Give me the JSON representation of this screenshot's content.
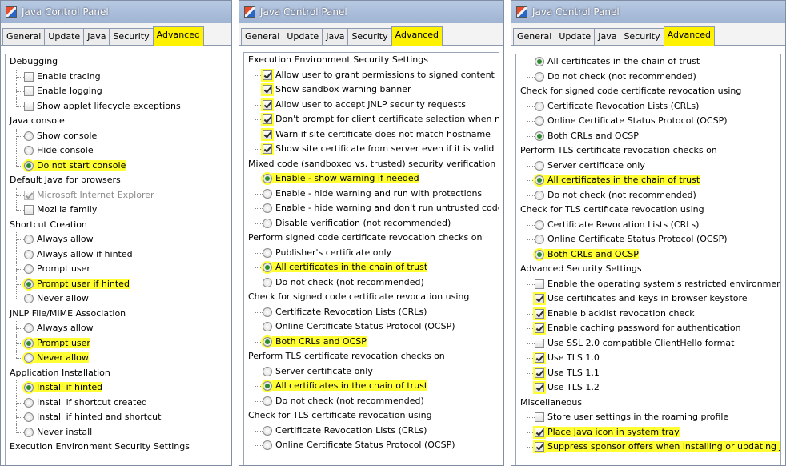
{
  "window_title": "Java Control Panel",
  "tabs": [
    "General",
    "Update",
    "Java",
    "Security",
    "Advanced"
  ],
  "panels": [
    {
      "rows": [
        {
          "kind": "cat",
          "label": "Debugging"
        },
        {
          "kind": "item",
          "ctl": "check",
          "label": "Enable tracing"
        },
        {
          "kind": "item",
          "ctl": "check",
          "label": "Enable logging"
        },
        {
          "kind": "item",
          "ctl": "check",
          "label": "Show applet lifecycle exceptions",
          "last": true
        },
        {
          "kind": "cat",
          "label": "Java console"
        },
        {
          "kind": "item",
          "ctl": "radio",
          "label": "Show console"
        },
        {
          "kind": "item",
          "ctl": "radio",
          "label": "Hide console"
        },
        {
          "kind": "item",
          "ctl": "radio",
          "label": "Do not start console",
          "selected": true,
          "highlight": true,
          "last": true
        },
        {
          "kind": "cat",
          "label": "Default Java for browsers"
        },
        {
          "kind": "item",
          "ctl": "check",
          "label": "Microsoft Internet Explorer",
          "checked": true,
          "disabled": true
        },
        {
          "kind": "item",
          "ctl": "check",
          "label": "Mozilla family",
          "last": true
        },
        {
          "kind": "cat",
          "label": "Shortcut Creation"
        },
        {
          "kind": "item",
          "ctl": "radio",
          "label": "Always allow"
        },
        {
          "kind": "item",
          "ctl": "radio",
          "label": "Always allow if hinted"
        },
        {
          "kind": "item",
          "ctl": "radio",
          "label": "Prompt user"
        },
        {
          "kind": "item",
          "ctl": "radio",
          "label": "Prompt user if hinted",
          "selected": true,
          "highlight": true
        },
        {
          "kind": "item",
          "ctl": "radio",
          "label": "Never allow",
          "last": true
        },
        {
          "kind": "cat",
          "label": "JNLP File/MIME Association"
        },
        {
          "kind": "item",
          "ctl": "radio",
          "label": "Always allow"
        },
        {
          "kind": "item",
          "ctl": "radio",
          "label": "Prompt user",
          "selected": true,
          "highlight": true
        },
        {
          "kind": "item",
          "ctl": "radio",
          "label": "Never allow",
          "highlight": true,
          "last": true
        },
        {
          "kind": "cat",
          "label": "Application Installation"
        },
        {
          "kind": "item",
          "ctl": "radio",
          "label": "Install if hinted",
          "selected": true,
          "highlight": true
        },
        {
          "kind": "item",
          "ctl": "radio",
          "label": "Install if shortcut created"
        },
        {
          "kind": "item",
          "ctl": "radio",
          "label": "Install if hinted and shortcut"
        },
        {
          "kind": "item",
          "ctl": "radio",
          "label": "Never install",
          "last": true
        },
        {
          "kind": "cat",
          "label": "Execution Environment Security Settings"
        }
      ]
    },
    {
      "rows": [
        {
          "kind": "cat",
          "label": "Execution Environment Security Settings"
        },
        {
          "kind": "item",
          "ctl": "check",
          "label": "Allow user to grant permissions to signed content",
          "checked": true,
          "highlight_box": true
        },
        {
          "kind": "item",
          "ctl": "check",
          "label": "Show sandbox warning banner",
          "checked": true,
          "highlight_box": true
        },
        {
          "kind": "item",
          "ctl": "check",
          "label": "Allow user to accept JNLP security requests",
          "checked": true,
          "highlight_box": true
        },
        {
          "kind": "item",
          "ctl": "check",
          "label": "Don't prompt for client certificate selection when no",
          "checked": true,
          "highlight_box": true
        },
        {
          "kind": "item",
          "ctl": "check",
          "label": "Warn if site certificate does not match hostname",
          "checked": true,
          "highlight_box": true
        },
        {
          "kind": "item",
          "ctl": "check",
          "label": "Show site certificate from server even if it is valid",
          "checked": true,
          "highlight_box": true,
          "last": true
        },
        {
          "kind": "cat",
          "label": "Mixed code (sandboxed vs. trusted) security verification"
        },
        {
          "kind": "item",
          "ctl": "radio",
          "label": "Enable - show warning if needed",
          "selected": true,
          "highlight": true
        },
        {
          "kind": "item",
          "ctl": "radio",
          "label": "Enable - hide warning and run with protections"
        },
        {
          "kind": "item",
          "ctl": "radio",
          "label": "Enable - hide warning and don't run untrusted code"
        },
        {
          "kind": "item",
          "ctl": "radio",
          "label": "Disable verification (not recommended)",
          "last": true
        },
        {
          "kind": "cat",
          "label": "Perform signed code certificate revocation checks on"
        },
        {
          "kind": "item",
          "ctl": "radio",
          "label": "Publisher's certificate only"
        },
        {
          "kind": "item",
          "ctl": "radio",
          "label": "All certificates in the chain of trust",
          "selected": true,
          "highlight": true
        },
        {
          "kind": "item",
          "ctl": "radio",
          "label": "Do not check (not recommended)",
          "last": true
        },
        {
          "kind": "cat",
          "label": "Check for signed code certificate revocation using"
        },
        {
          "kind": "item",
          "ctl": "radio",
          "label": "Certificate Revocation Lists (CRLs)"
        },
        {
          "kind": "item",
          "ctl": "radio",
          "label": "Online Certificate Status Protocol (OCSP)"
        },
        {
          "kind": "item",
          "ctl": "radio",
          "label": "Both CRLs and OCSP",
          "selected": true,
          "highlight": true,
          "last": true
        },
        {
          "kind": "cat",
          "label": "Perform TLS certificate revocation checks on"
        },
        {
          "kind": "item",
          "ctl": "radio",
          "label": "Server certificate only"
        },
        {
          "kind": "item",
          "ctl": "radio",
          "label": "All certificates in the chain of trust",
          "selected": true,
          "highlight": true
        },
        {
          "kind": "item",
          "ctl": "radio",
          "label": "Do not check (not recommended)",
          "last": true
        },
        {
          "kind": "cat",
          "label": "Check for TLS certificate revocation using"
        },
        {
          "kind": "item",
          "ctl": "radio",
          "label": "Certificate Revocation Lists (CRLs)"
        },
        {
          "kind": "item",
          "ctl": "radio",
          "label": "Online Certificate Status Protocol (OCSP)"
        }
      ]
    },
    {
      "rows": [
        {
          "kind": "item",
          "ctl": "radio",
          "label": "All certificates in the chain of trust",
          "selected": true,
          "cont": true
        },
        {
          "kind": "item",
          "ctl": "radio",
          "label": "Do not check (not recommended)",
          "last": true
        },
        {
          "kind": "cat",
          "label": "Check for signed code certificate revocation using"
        },
        {
          "kind": "item",
          "ctl": "radio",
          "label": "Certificate Revocation Lists (CRLs)"
        },
        {
          "kind": "item",
          "ctl": "radio",
          "label": "Online Certificate Status Protocol (OCSP)"
        },
        {
          "kind": "item",
          "ctl": "radio",
          "label": "Both CRLs and OCSP",
          "selected": true,
          "last": true
        },
        {
          "kind": "cat",
          "label": "Perform TLS certificate revocation checks on"
        },
        {
          "kind": "item",
          "ctl": "radio",
          "label": "Server certificate only"
        },
        {
          "kind": "item",
          "ctl": "radio",
          "label": "All certificates in the chain of trust",
          "selected": true,
          "highlight": true
        },
        {
          "kind": "item",
          "ctl": "radio",
          "label": "Do not check (not recommended)",
          "last": true
        },
        {
          "kind": "cat",
          "label": "Check for TLS certificate revocation using"
        },
        {
          "kind": "item",
          "ctl": "radio",
          "label": "Certificate Revocation Lists (CRLs)"
        },
        {
          "kind": "item",
          "ctl": "radio",
          "label": "Online Certificate Status Protocol (OCSP)"
        },
        {
          "kind": "item",
          "ctl": "radio",
          "label": "Both CRLs and OCSP",
          "selected": true,
          "highlight": true,
          "last": true
        },
        {
          "kind": "cat",
          "label": "Advanced Security Settings"
        },
        {
          "kind": "item",
          "ctl": "check",
          "label": "Enable the operating system's restricted environment (n"
        },
        {
          "kind": "item",
          "ctl": "check",
          "label": "Use certificates and keys in browser keystore",
          "checked": true,
          "highlight_box": true
        },
        {
          "kind": "item",
          "ctl": "check",
          "label": "Enable blacklist revocation check",
          "checked": true,
          "highlight_box": true
        },
        {
          "kind": "item",
          "ctl": "check",
          "label": "Enable caching password for authentication",
          "checked": true,
          "highlight_box": true
        },
        {
          "kind": "item",
          "ctl": "check",
          "label": "Use SSL 2.0 compatible ClientHello format"
        },
        {
          "kind": "item",
          "ctl": "check",
          "label": "Use TLS 1.0",
          "checked": true,
          "highlight_box": true
        },
        {
          "kind": "item",
          "ctl": "check",
          "label": "Use TLS 1.1",
          "checked": true,
          "highlight_box": true
        },
        {
          "kind": "item",
          "ctl": "check",
          "label": "Use TLS 1.2",
          "checked": true,
          "highlight_box": true,
          "last": true
        },
        {
          "kind": "cat",
          "label": "Miscellaneous"
        },
        {
          "kind": "item",
          "ctl": "check",
          "label": "Store user settings in the roaming profile"
        },
        {
          "kind": "item",
          "ctl": "check",
          "label": "Place Java icon in system tray",
          "checked": true,
          "highlight": true
        },
        {
          "kind": "item",
          "ctl": "check",
          "label": "Suppress sponsor offers when installing or updating Java",
          "checked": true,
          "highlight": true,
          "last": true
        }
      ]
    }
  ],
  "colors": {
    "highlight": "#ffff33",
    "selected_radio": "#2f8a2f",
    "titlebar": "#9fb4d3"
  }
}
